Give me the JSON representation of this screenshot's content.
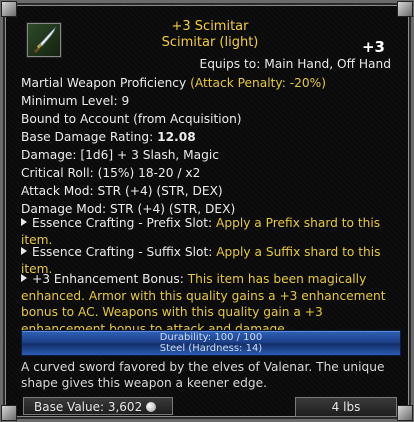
{
  "item": {
    "name": "+3 Scimitar",
    "subtitle": "Scimitar (light)",
    "enhancement": "+3",
    "equips": "Equips to: Main Hand, Off Hand"
  },
  "props": {
    "proficiency_prefix": "Martial Weapon Proficiency ",
    "proficiency_penalty": "(Attack Penalty: -20%)",
    "min_level": "Minimum Level: 9",
    "bound": "Bound to Account (from Acquisition)",
    "base_damage_label": "Base Damage Rating: ",
    "base_damage_value": "12.08",
    "damage": "Damage: [1d6] + 3 Slash, Magic",
    "critical": "Critical Roll: (15%) 18-20 / x2",
    "attack_mod": "Attack Mod: STR (+4) (STR, DEX)",
    "damage_mod": "Damage Mod: STR (+4) (STR, DEX)"
  },
  "slots": [
    {
      "name": "Essence Crafting - Prefix Slot: ",
      "text": "Apply a Prefix shard to this item."
    },
    {
      "name": "Essence Crafting - Suffix Slot: ",
      "text": "Apply a Suffix shard to this item."
    },
    {
      "name": "+3 Enhancement Bonus: ",
      "text": "This item has been magically enhanced. Armor with this quality gains a +3 enhancement bonus to AC. Weapons with this quality gain a +3 enhancement bonus to attack and damage."
    }
  ],
  "durability": {
    "line1": "Durability: 100 / 100",
    "line2": "Steel (Hardness: 14)"
  },
  "description": "A curved sword favored by the elves of Valenar. The unique shape gives this weapon a keener edge.",
  "footer": {
    "base_value": "Base Value: 3,602",
    "weight": "4 lbs"
  },
  "icons": {
    "item": "scimitar-icon",
    "currency": "platinum-coin-icon"
  }
}
